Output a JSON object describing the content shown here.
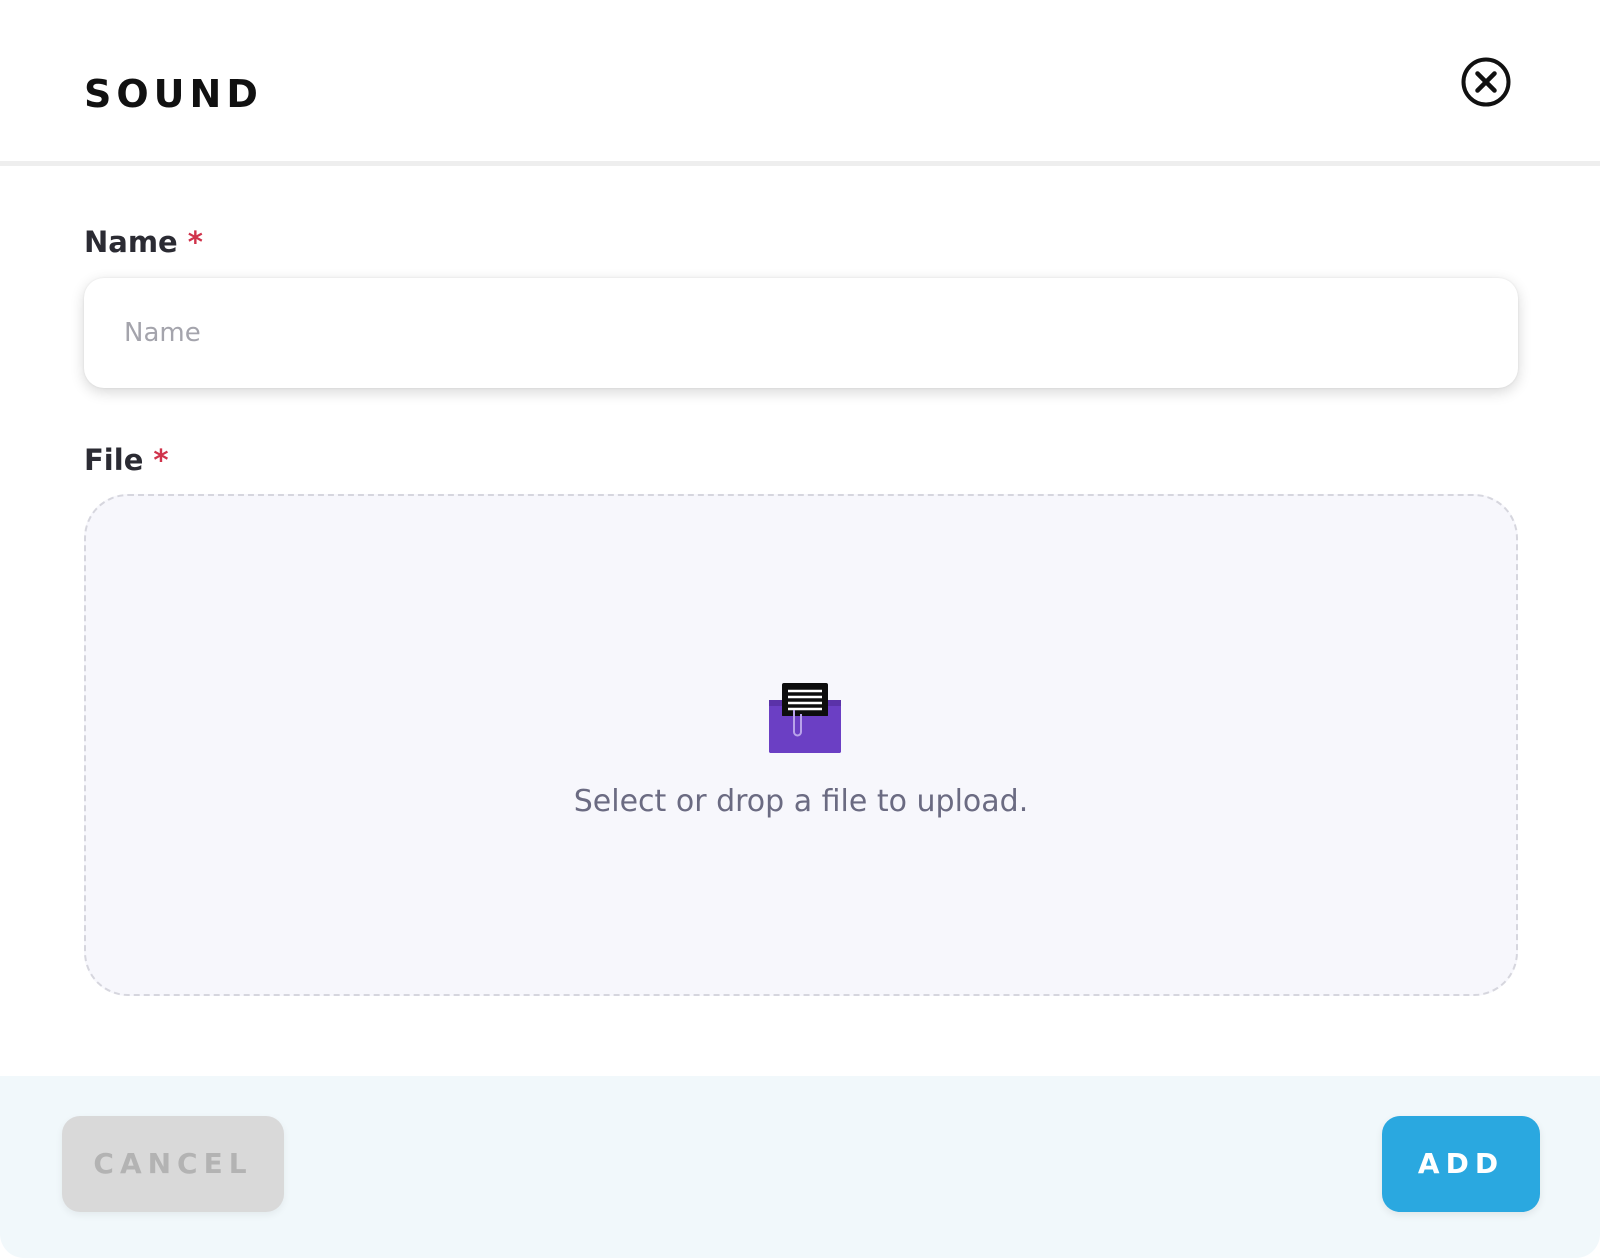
{
  "dialog": {
    "title": "SOUND",
    "close_icon": "close-circle-icon"
  },
  "form": {
    "name": {
      "label": "Name",
      "required_marker": "*",
      "value": "",
      "placeholder": "Name"
    },
    "file": {
      "label": "File",
      "required_marker": "*",
      "icon": "inbox-tray-icon",
      "dropzone_text": "Select or drop a file to upload."
    }
  },
  "footer": {
    "cancel_label": "CANCEL",
    "add_label": "ADD"
  },
  "colors": {
    "accent": "#2aa8e0",
    "required": "#d0334b",
    "dropzone_bg": "#f7f7fc",
    "footer_bg": "#f1f8fb",
    "icon_purple": "#6b3fc4"
  }
}
